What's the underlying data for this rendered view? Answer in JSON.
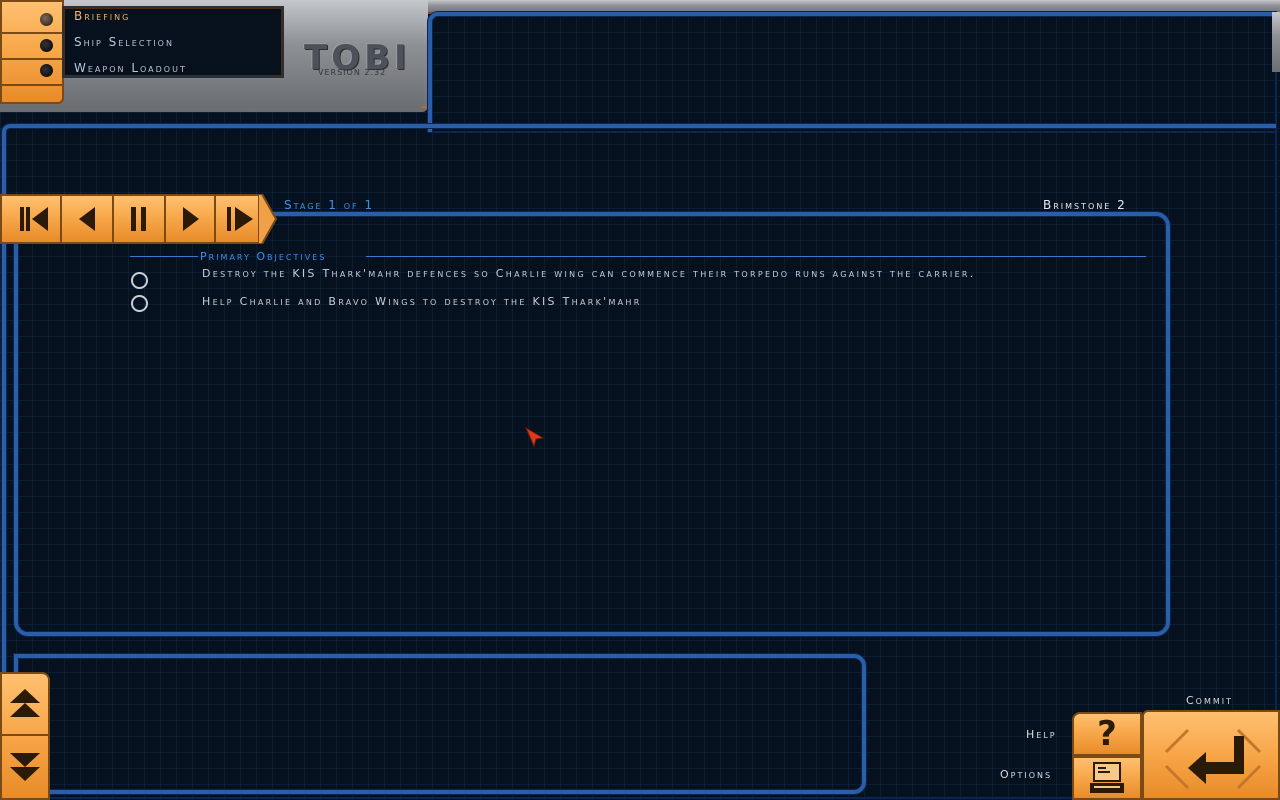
{
  "menu": {
    "items": [
      {
        "label": "Briefing",
        "active": true
      },
      {
        "label": "Ship Selection",
        "active": false
      },
      {
        "label": "Weapon Loadout",
        "active": false
      }
    ]
  },
  "logo": {
    "name": "TOBI",
    "version": "VERSION 2.32"
  },
  "briefing": {
    "stage_label": "Stage 1 of 1",
    "ship_name": "Brimstone 2",
    "objectives_heading": "Primary Objectives",
    "objectives": [
      "Destroy the KIS Thark'mahr defences so Charlie wing can commence their torpedo runs against the carrier.",
      "Help Charlie and Bravo Wings to destroy the KIS Thark'mahr"
    ]
  },
  "controls": {
    "icons": [
      "skip-to-start-icon",
      "previous-icon",
      "pause-icon",
      "next-icon",
      "skip-to-end-icon"
    ]
  },
  "bottom": {
    "commit_label": "Commit",
    "help_label": "Help",
    "options_label": "Options",
    "help_symbol": "?"
  },
  "colors": {
    "accent_orange": "#f7a648",
    "frame_blue": "#2a5ea8",
    "heading_blue": "#3e8fe8",
    "active_menu": "#f2b566",
    "cursor_red": "#e03a1a"
  }
}
